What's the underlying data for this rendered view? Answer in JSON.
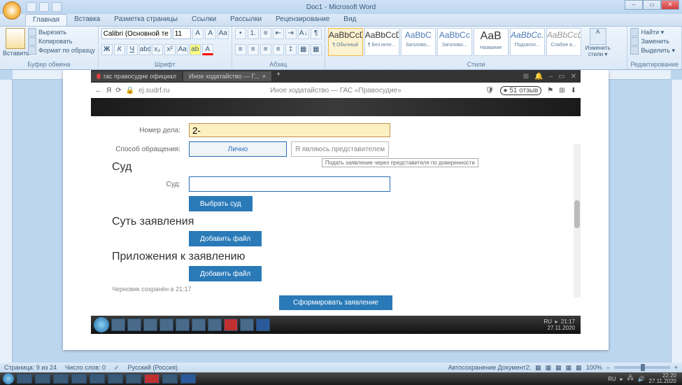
{
  "titlebar": {
    "title": "Doc1 - Microsoft Word"
  },
  "ribbon": {
    "tabs": [
      "Главная",
      "Вставка",
      "Разметка страницы",
      "Ссылки",
      "Рассылки",
      "Рецензирование",
      "Вид"
    ],
    "clipboard": {
      "paste": "Вставить",
      "cut": "Вырезать",
      "copy": "Копировать",
      "format_painter": "Формат по образцу",
      "group": "Буфер обмена"
    },
    "font": {
      "name": "Calibri (Основной те",
      "size": "11",
      "group": "Шрифт"
    },
    "paragraph": {
      "group": "Абзац"
    },
    "styles": {
      "items": [
        {
          "sample": "AaBbCcDc",
          "name": "¶ Обычный"
        },
        {
          "sample": "AaBbCcDc",
          "name": "¶ Без инте..."
        },
        {
          "sample": "AaBbC",
          "name": "Заголово..."
        },
        {
          "sample": "AaBbCc",
          "name": "Заголово..."
        },
        {
          "sample": "AaB",
          "name": "Название"
        },
        {
          "sample": "AaBbCc.",
          "name": "Подзагол..."
        },
        {
          "sample": "AaBbCcDc",
          "name": "Слабое в..."
        }
      ],
      "change": "Изменить стили ▾",
      "group": "Стили"
    },
    "editing": {
      "find": "Найти ▾",
      "replace": "Заменить",
      "select": "Выделить ▾",
      "group": "Редактирование"
    }
  },
  "browser": {
    "tab1": "гас правосудие официал",
    "tab2": "Иное ходатайство — Г...",
    "url": "ej.sudrf.ru",
    "page_title": "Иное ходатайство — ГАС «Правосудие»",
    "reviews": "51 отзыв"
  },
  "form": {
    "case_label": "Номер дела:",
    "case_value": "2-",
    "method_label": "Способ обращения:",
    "method_personal": "Лично",
    "method_rep": "Я являюсь представителем",
    "tooltip": "Подать заявление через представителя по доверенности",
    "court_section": "Суд",
    "court_label": "Суд:",
    "select_court": "Выбрать суд",
    "essence_section": "Суть заявления",
    "add_file": "Добавить файл",
    "attachments_section": "Приложения к заявлению",
    "draft_saved": "Черновик сохранён в 21:17",
    "submit": "Сформировать заявление"
  },
  "inner_tray": {
    "lang": "RU",
    "time": "21:17",
    "date": "27.11.2020"
  },
  "status": {
    "page": "Страница: 9 из 24",
    "words": "Число слов: 0",
    "lang": "Русский (Россия)",
    "autosave": "Автосохранение Документ2:",
    "zoom": "100%"
  },
  "win_tray": {
    "lang": "RU",
    "time": "22:20",
    "date": "27.11.2020"
  }
}
